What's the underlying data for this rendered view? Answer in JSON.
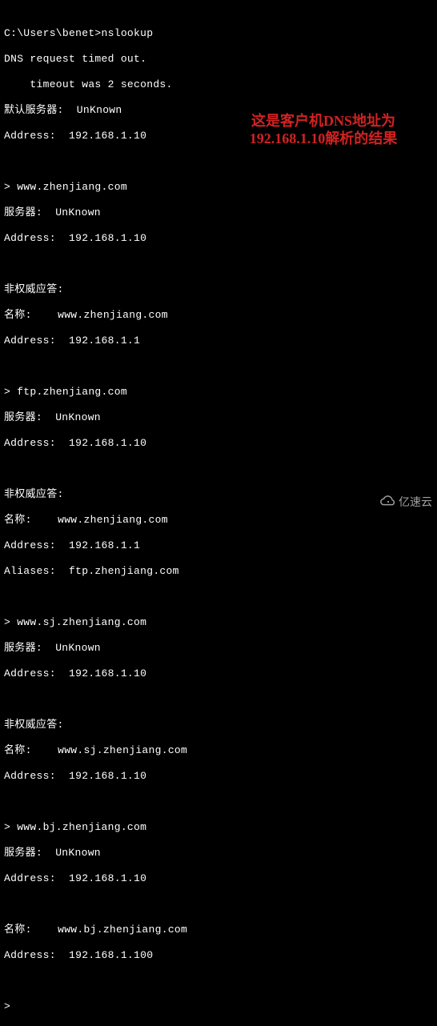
{
  "terminal": {
    "l01": "C:\\Users\\benet>nslookup",
    "l02": "DNS request timed out.",
    "l03": "    timeout was 2 seconds.",
    "l04": "默认服务器:  UnKnown",
    "l05": "Address:  192.168.1.10",
    "l06": "",
    "l07": "> www.zhenjiang.com",
    "l08": "服务器:  UnKnown",
    "l09": "Address:  192.168.1.10",
    "l10": "",
    "l11": "非权威应答:",
    "l12": "名称:    www.zhenjiang.com",
    "l13": "Address:  192.168.1.1",
    "l14": "",
    "l15": "> ftp.zhenjiang.com",
    "l16": "服务器:  UnKnown",
    "l17": "Address:  192.168.1.10",
    "l18": "",
    "l19": "非权威应答:",
    "l20": "名称:    www.zhenjiang.com",
    "l21": "Address:  192.168.1.1",
    "l22": "Aliases:  ftp.zhenjiang.com",
    "l23": "",
    "l24": "> www.sj.zhenjiang.com",
    "l25": "服务器:  UnKnown",
    "l26": "Address:  192.168.1.10",
    "l27": "",
    "l28": "非权威应答:",
    "l29": "名称:    www.sj.zhenjiang.com",
    "l30": "Address:  192.168.1.10",
    "l31": "",
    "l32": "> www.bj.zhenjiang.com",
    "l33": "服务器:  UnKnown",
    "l34": "Address:  192.168.1.10",
    "l35": "",
    "l36": "名称:    www.bj.zhenjiang.com",
    "l37": "Address:  192.168.1.100",
    "l38": "",
    "l39": "> "
  },
  "annotation": {
    "line1": "这是客户机DNS地址为",
    "line2": "192.168.1.10解析的结果"
  },
  "watermark": {
    "text": "亿速云"
  }
}
